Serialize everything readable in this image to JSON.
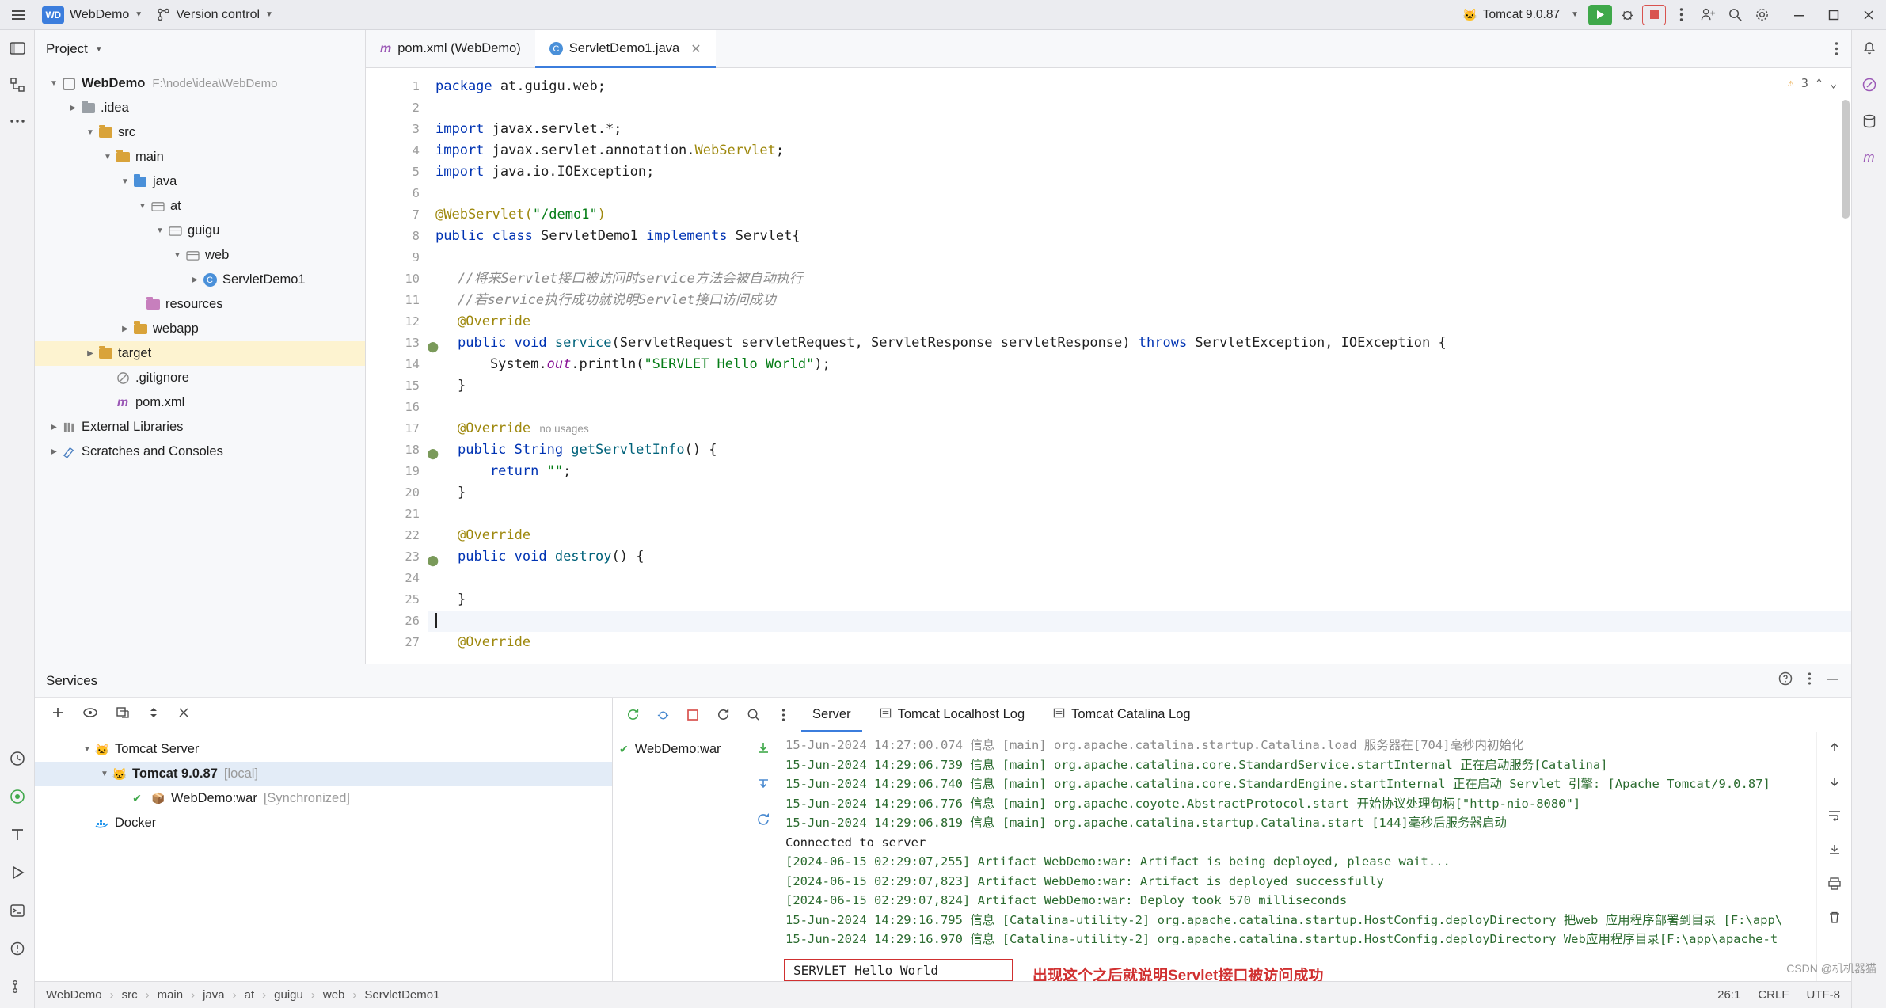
{
  "titlebar": {
    "project_badge": "WD",
    "project_name": "WebDemo",
    "version_control": "Version control",
    "run_config": "Tomcat 9.0.87",
    "icons": {
      "menu": "hamburger-menu-icon",
      "main_menu": "main-menu-icon",
      "search": "search-icon",
      "settings": "gear-icon",
      "account": "add-account-icon",
      "more": "more-vertical-icon",
      "run": "run-icon",
      "debug": "debug-icon",
      "stop": "stop-icon",
      "minimize": "minimize-icon",
      "maximize": "maximize-icon",
      "close": "close-icon"
    }
  },
  "project_pane": {
    "title": "Project",
    "tree": [
      {
        "depth": 0,
        "arrow": "down",
        "icon": "module",
        "label": "WebDemo",
        "path": "F:\\node\\idea\\WebDemo",
        "bold": true,
        "selected": false
      },
      {
        "depth": 1,
        "arrow": "right",
        "icon": "folder",
        "label": ".idea",
        "path": "",
        "bold": false,
        "selected": false
      },
      {
        "depth": 1,
        "arrow": "down",
        "icon": "folder",
        "label": "src",
        "path": "",
        "bold": false,
        "selected": false
      },
      {
        "depth": 2,
        "arrow": "down",
        "icon": "folder",
        "label": "main",
        "path": "",
        "bold": false,
        "selected": false
      },
      {
        "depth": 3,
        "arrow": "down",
        "icon": "srcdir",
        "label": "java",
        "path": "",
        "bold": false,
        "selected": false
      },
      {
        "depth": 4,
        "arrow": "down",
        "icon": "pkg",
        "label": "at",
        "path": "",
        "bold": false,
        "selected": false
      },
      {
        "depth": 5,
        "arrow": "down",
        "icon": "pkg",
        "label": "guigu",
        "path": "",
        "bold": false,
        "selected": false
      },
      {
        "depth": 6,
        "arrow": "down",
        "icon": "pkg",
        "label": "web",
        "path": "",
        "bold": false,
        "selected": false
      },
      {
        "depth": 7,
        "arrow": "right",
        "icon": "class",
        "label": "ServletDemo1",
        "path": "",
        "bold": false,
        "selected": false
      },
      {
        "depth": 4,
        "arrow": "none",
        "icon": "res",
        "label": "resources",
        "path": "",
        "bold": false,
        "selected": false
      },
      {
        "depth": 3,
        "arrow": "right",
        "icon": "folder",
        "label": "webapp",
        "path": "",
        "bold": false,
        "selected": false
      },
      {
        "depth": 1,
        "arrow": "right",
        "icon": "target",
        "label": "target",
        "path": "",
        "bold": false,
        "selected": true
      },
      {
        "depth": 2,
        "arrow": "none",
        "icon": "ignore",
        "label": ".gitignore",
        "path": "",
        "bold": false,
        "selected": false
      },
      {
        "depth": 2,
        "arrow": "none",
        "icon": "maven",
        "label": "pom.xml",
        "path": "",
        "bold": false,
        "selected": false
      },
      {
        "depth": 0,
        "arrow": "right",
        "icon": "lib",
        "label": "External Libraries",
        "path": "",
        "bold": false,
        "selected": false
      },
      {
        "depth": 0,
        "arrow": "right",
        "icon": "scratch",
        "label": "Scratches and Consoles",
        "path": "",
        "bold": false,
        "selected": false
      }
    ]
  },
  "editor": {
    "tabs": [
      {
        "icon": "maven-icon",
        "label": "pom.xml (WebDemo)",
        "active": false,
        "closable": false
      },
      {
        "icon": "class-icon",
        "label": "ServletDemo1.java",
        "active": true,
        "closable": true
      }
    ],
    "warning_count": "3",
    "lines": [
      {
        "n": "1",
        "marker": false,
        "current": false
      },
      {
        "n": "2",
        "marker": false,
        "current": false
      },
      {
        "n": "3",
        "marker": false,
        "current": false
      },
      {
        "n": "4",
        "marker": false,
        "current": false
      },
      {
        "n": "5",
        "marker": false,
        "current": false
      },
      {
        "n": "6",
        "marker": false,
        "current": false
      },
      {
        "n": "7",
        "marker": false,
        "current": false
      },
      {
        "n": "8",
        "marker": false,
        "current": false
      },
      {
        "n": "9",
        "marker": false,
        "current": false
      },
      {
        "n": "10",
        "marker": false,
        "current": false
      },
      {
        "n": "11",
        "marker": false,
        "current": false
      },
      {
        "n": "12",
        "marker": false,
        "current": false
      },
      {
        "n": "13",
        "marker": true,
        "current": false
      },
      {
        "n": "14",
        "marker": false,
        "current": false
      },
      {
        "n": "15",
        "marker": false,
        "current": false
      },
      {
        "n": "16",
        "marker": false,
        "current": false
      },
      {
        "n": "17",
        "marker": false,
        "current": false
      },
      {
        "n": "18",
        "marker": true,
        "current": false
      },
      {
        "n": "19",
        "marker": false,
        "current": false
      },
      {
        "n": "20",
        "marker": false,
        "current": false
      },
      {
        "n": "21",
        "marker": false,
        "current": false
      },
      {
        "n": "22",
        "marker": false,
        "current": false
      },
      {
        "n": "23",
        "marker": true,
        "current": false
      },
      {
        "n": "24",
        "marker": false,
        "current": false
      },
      {
        "n": "25",
        "marker": false,
        "current": false
      },
      {
        "n": "26",
        "marker": false,
        "current": true
      },
      {
        "n": "27",
        "marker": false,
        "current": false
      }
    ],
    "code": {
      "l1_kw": "package",
      "l1_rest": " at.guigu.web;",
      "l3_kw": "import",
      "l3_rest": " javax.servlet.*;",
      "l4_kw": "import",
      "l4_mid": " javax.servlet.annotation.",
      "l4_type": "WebServlet",
      "l4_end": ";",
      "l5_kw": "import",
      "l5_rest": " java.io.IOException;",
      "l7_ann": "@WebServlet(",
      "l7_str": "\"/demo1\"",
      "l7_end": ")",
      "l8_kw1": "public",
      "l8_kw2": "class",
      "l8_name": " ServletDemo1 ",
      "l8_kw3": "implements",
      "l8_end": " Servlet{",
      "l10_comment": "//将来Servlet接口被访问时service方法会被自动执行",
      "l11_comment": "//若service执行成功就说明Servlet接口访问成功",
      "l12_ann": "@Override",
      "l13_kw": "public void ",
      "l13_fn": "service",
      "l13_args": "(ServletRequest servletRequest, ServletResponse servletResponse) ",
      "l13_throws": "throws",
      "l13_ex": " ServletException, IOException {",
      "l14_a": "    System.",
      "l14_out": "out",
      "l14_b": ".println(",
      "l14_str": "\"SERVLET Hello World\"",
      "l14_c": ");",
      "l15": "}",
      "l17_ann": "@Override",
      "l17_usage": "no usages",
      "l18_kw": "public String ",
      "l18_fn": "getServletInfo",
      "l18_end": "() {",
      "l19_kw": "    return ",
      "l19_str": "\"\"",
      "l19_end": ";",
      "l20": "}",
      "l22_ann": "@Override",
      "l23_kw": "public void ",
      "l23_fn": "destroy",
      "l23_end": "() {",
      "l25": "}",
      "l27_ann": "@Override"
    }
  },
  "services": {
    "title": "Services",
    "tree": [
      {
        "depth": 0,
        "arrow": "down",
        "icon": "tomcat",
        "label": "Tomcat Server",
        "suffix": "",
        "selected": false,
        "check": false
      },
      {
        "depth": 1,
        "arrow": "down",
        "icon": "tomcat",
        "label": "Tomcat 9.0.87",
        "suffix": "[local]",
        "selected": true,
        "check": false,
        "bold": true
      },
      {
        "depth": 2,
        "arrow": "none",
        "icon": "war",
        "label": "WebDemo:war",
        "suffix": "[Synchronized]",
        "selected": false,
        "check": true
      },
      {
        "depth": 0,
        "arrow": "none",
        "icon": "docker",
        "label": "Docker",
        "suffix": "",
        "selected": false,
        "check": false
      }
    ],
    "tabs": [
      {
        "label": "Server",
        "active": true,
        "icon": ""
      },
      {
        "label": "Tomcat Localhost Log",
        "active": false,
        "icon": "log-icon"
      },
      {
        "label": "Tomcat Catalina Log",
        "active": false,
        "icon": "log-icon"
      }
    ],
    "deployment": {
      "label": "WebDemo:war",
      "check": true
    },
    "console_lines": [
      {
        "text": "15-Jun-2024 14:27:00.074 信息 [main] org.apache.catalina.startup.Catalina.load 服务器在[704]毫秒内初始化",
        "style": "first"
      },
      {
        "text": "15-Jun-2024 14:29:06.739 信息 [main] org.apache.catalina.core.StandardService.startInternal 正在启动服务[Catalina]",
        "style": "green"
      },
      {
        "text": "15-Jun-2024 14:29:06.740 信息 [main] org.apache.catalina.core.StandardEngine.startInternal 正在启动 Servlet 引擎: [Apache Tomcat/9.0.87]",
        "style": "green"
      },
      {
        "text": "15-Jun-2024 14:29:06.776 信息 [main] org.apache.coyote.AbstractProtocol.start 开始协议处理句柄[\"http-nio-8080\"]",
        "style": "green"
      },
      {
        "text": "15-Jun-2024 14:29:06.819 信息 [main] org.apache.catalina.startup.Catalina.start [144]毫秒后服务器启动",
        "style": "green"
      },
      {
        "text": "Connected to server",
        "style": "plain"
      },
      {
        "text": "[2024-06-15 02:29:07,255] Artifact WebDemo:war: Artifact is being deployed, please wait...",
        "style": "green"
      },
      {
        "text": "[2024-06-15 02:29:07,823] Artifact WebDemo:war: Artifact is deployed successfully",
        "style": "green"
      },
      {
        "text": "[2024-06-15 02:29:07,824] Artifact WebDemo:war: Deploy took 570 milliseconds",
        "style": "green"
      },
      {
        "text": "15-Jun-2024 14:29:16.795 信息 [Catalina-utility-2] org.apache.catalina.startup.HostConfig.deployDirectory 把web 应用程序部署到目录 [F:\\app\\",
        "style": "green"
      },
      {
        "text": "15-Jun-2024 14:29:16.970 信息 [Catalina-utility-2] org.apache.catalina.startup.HostConfig.deployDirectory Web应用程序目录[F:\\app\\apache-t",
        "style": "green"
      }
    ],
    "highlight_output": "SERVLET Hello World",
    "annotation": "出现这个之后就说明Servlet接口被访问成功"
  },
  "status": {
    "breadcrumb": [
      "WebDemo",
      "src",
      "main",
      "java",
      "at",
      "guigu",
      "web",
      "ServletDemo1"
    ],
    "caret": "26:1",
    "line_sep": "CRLF",
    "encoding": "UTF-8",
    "watermark": "CSDN @机机器猫"
  }
}
